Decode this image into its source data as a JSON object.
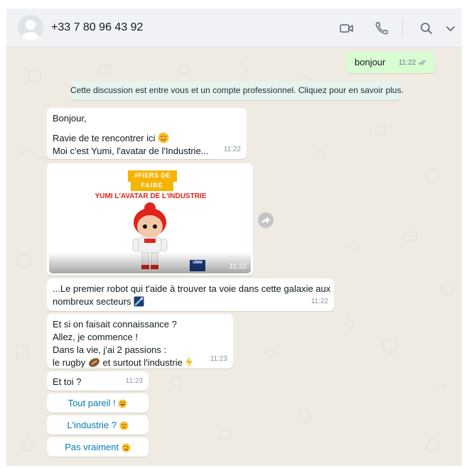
{
  "header": {
    "contact_name": "+33 7 80 96 43 92",
    "icons": [
      "video-call-icon",
      "voice-call-icon",
      "search-icon",
      "menu-chevron-icon"
    ],
    "background": "#f0f2f5"
  },
  "chat": {
    "background": "#efeae2",
    "outgoing": {
      "text": "bonjour",
      "time": "11:22",
      "status": "read-double-check"
    },
    "system_notice": "Cette discussion est entre vous et un compte professionnel. Cliquez pour en savoir plus.",
    "messages": [
      {
        "line1": "Bonjour,",
        "line2": "Ravie de te rencontrer ici",
        "line3": "Moi c'est Yumi, l'avatar de l'Industrie...",
        "time": "11:22",
        "emoji": "smiling-face"
      },
      {
        "media": {
          "banner_line1": "#FIERS DE",
          "banner_line2": "FAIRE",
          "title": "YUMI L'AVATAR DE L'INDUSTRIE",
          "logo": "UIMM",
          "time": "11:22"
        }
      },
      {
        "line1": "...Le premier robot qui t'aide à trouver ta voie dans cette galaxie aux",
        "line2": "nombreux secteurs",
        "time": "11:22",
        "emoji": "comet"
      },
      {
        "line1": "Et si on faisait connaissance ?",
        "line2": "Allez, je commence !",
        "line3": "Dans la vie, j'ai 2 passions :",
        "line4a": "le rugby",
        "line4b": "et surtout l'industrie",
        "time": "11:23",
        "emojis": [
          "rugby-ball",
          "lightning"
        ]
      },
      {
        "line1": "Et toi ?",
        "time": "11:23"
      }
    ],
    "quick_replies": [
      {
        "label": "Tout pareil !",
        "emoji": "grinning-face"
      },
      {
        "label": "L'industrie ?",
        "emoji": "thinking-face"
      },
      {
        "label": "Pas vraiment",
        "emoji": "winking-tongue-face"
      }
    ],
    "colors": {
      "outgoing_bubble": "#d9fdd3",
      "incoming_bubble": "#ffffff",
      "system_bubble": "#e6f4ee",
      "quick_reply_text": "#027eb5",
      "banner_yellow": "#f5b400",
      "banner_red": "#e2231a"
    }
  }
}
